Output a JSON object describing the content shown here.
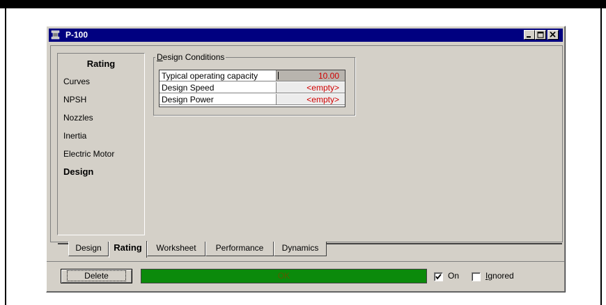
{
  "window": {
    "title": "P-100"
  },
  "sidebar": {
    "header": "Rating",
    "items": [
      {
        "label": "Curves",
        "active": false
      },
      {
        "label": "NPSH",
        "active": false
      },
      {
        "label": "Nozzles",
        "active": false
      },
      {
        "label": "Inertia",
        "active": false
      },
      {
        "label": "Electric Motor",
        "active": false
      },
      {
        "label": "Design",
        "active": true
      }
    ]
  },
  "design_conditions": {
    "legend_prefix": "D",
    "legend_rest": "esign Conditions",
    "rows": [
      {
        "name": "Typical operating capacity",
        "value": "10.00"
      },
      {
        "name": "Design Speed",
        "value": "<empty>"
      },
      {
        "name": "Design Power",
        "value": "<empty>"
      }
    ]
  },
  "tabs": [
    {
      "label": "Design",
      "active": false
    },
    {
      "label": "Rating",
      "active": true
    },
    {
      "label": "Worksheet",
      "active": false
    },
    {
      "label": "Performance",
      "active": false
    },
    {
      "label": "Dynamics",
      "active": false
    }
  ],
  "footer": {
    "delete_label": "Delete",
    "status_text": "OK",
    "status_color": "#0b8a0b",
    "on_label": "On",
    "on_checked": true,
    "ignored_prefix": "I",
    "ignored_rest": "gnored",
    "ignored_checked": false
  }
}
